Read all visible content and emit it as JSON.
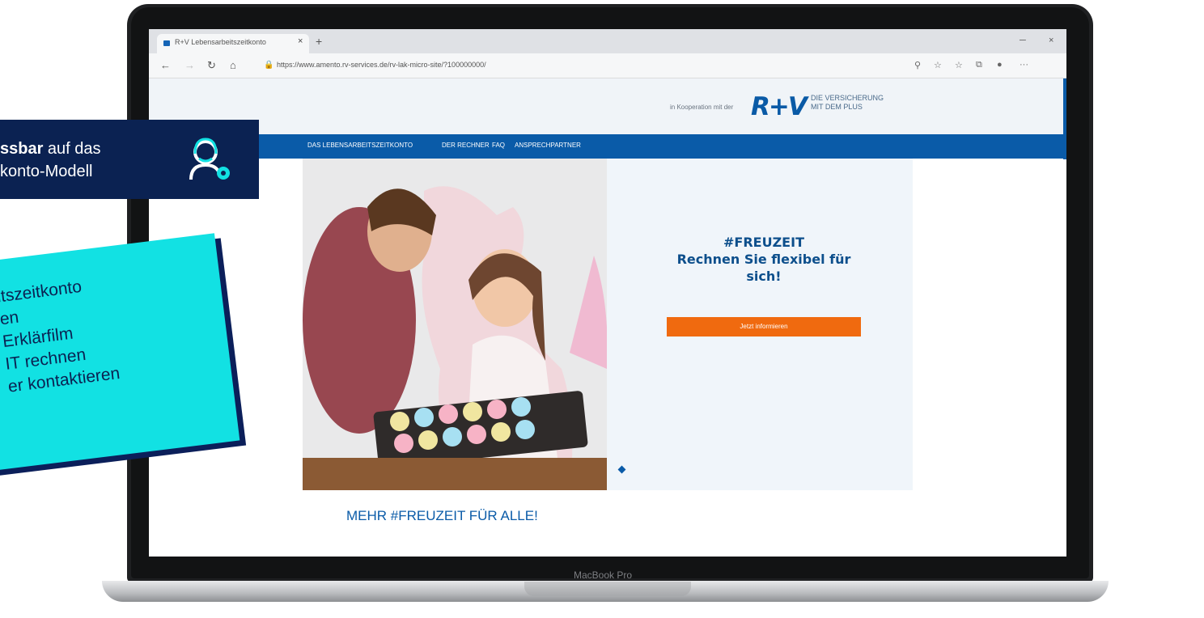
{
  "browser": {
    "tab_title": "R+V Lebensarbeitszeitkonto",
    "tab_close": "×",
    "new_tab": "+",
    "window_min": "─",
    "window_close": "×",
    "nav_back": "←",
    "nav_forward": "→",
    "nav_reload": "↻",
    "nav_home": "⌂",
    "lock_icon": "🔒",
    "url": "https://www.amento.rv-services.de/rv-lak-micro-site/?100000000/",
    "right_icons": [
      "⚲",
      "☆",
      "☆",
      "⧉",
      "●",
      "···"
    ]
  },
  "page": {
    "header": {
      "cooperation_text": "in Kooperation mit der",
      "logo_text": "R+V",
      "logo_tagline_1": "DIE VERSICHERUNG",
      "logo_tagline_2": "MIT DEM PLUS"
    },
    "nav": {
      "items": [
        "DAS LEBENSARBEITSZEITKONTO",
        "DER RECHNER",
        "FAQ",
        "ANSPRECHPARTNER"
      ]
    },
    "hero": {
      "headline_1": "#FREUZEIT",
      "headline_2": "Rechnen Sie flexibel für",
      "headline_3": "sich!",
      "button_label": "Jetzt informieren"
    },
    "section_title": "MEHR #FREUZEIT FÜR ALLE!"
  },
  "laptop": {
    "label": "MacBook Pro"
  },
  "callout": {
    "line1_bold": "ssbar",
    "line1_rest": " auf das",
    "line2": "konto-Modell"
  },
  "cyan_card": {
    "items": [
      "itszeitkonto",
      "en",
      "Erklärfilm",
      "IT rechnen",
      "er kontaktieren"
    ]
  },
  "colors": {
    "navy": "#0b2252",
    "rv_blue": "#0a5ba8",
    "orange": "#f06a0f",
    "cyan": "#12e1e3"
  }
}
